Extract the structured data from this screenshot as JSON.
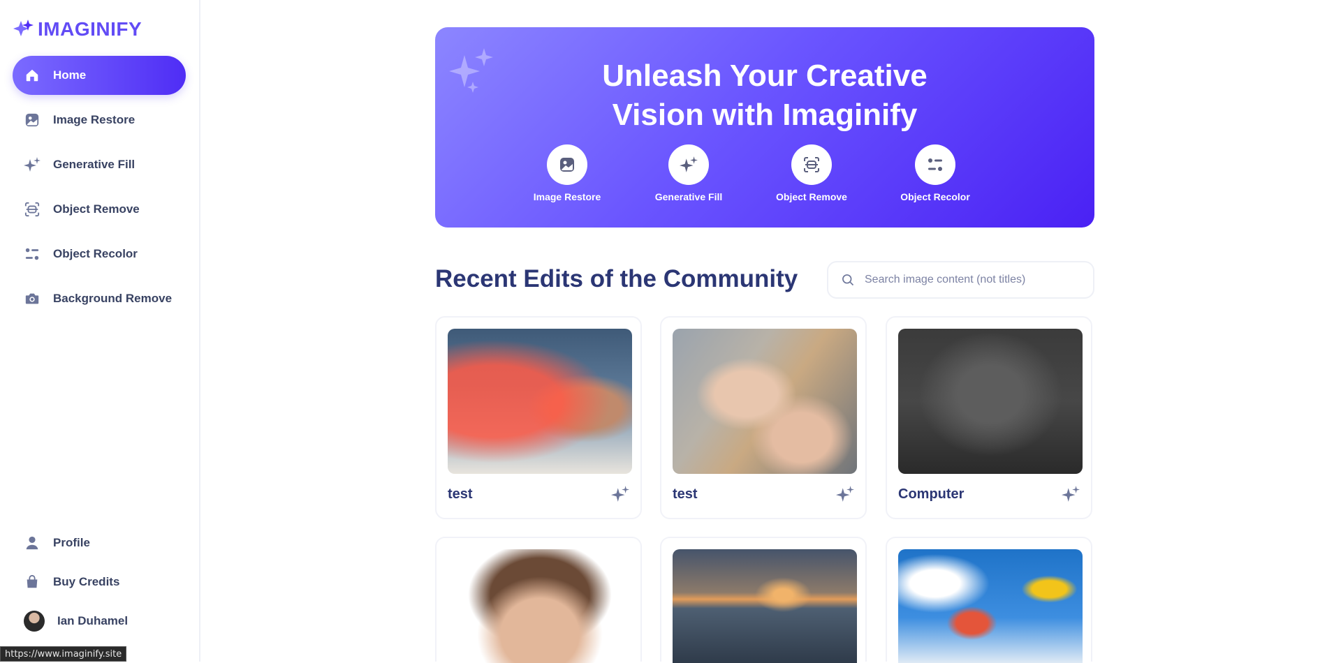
{
  "brand": {
    "name": "IMAGINIFY",
    "color": "#624cf5"
  },
  "sidebar": {
    "items": [
      {
        "label": "Home",
        "icon": "home-icon",
        "active": true
      },
      {
        "label": "Image Restore",
        "icon": "image-icon"
      },
      {
        "label": "Generative Fill",
        "icon": "stars-icon"
      },
      {
        "label": "Object Remove",
        "icon": "scan-icon"
      },
      {
        "label": "Object Recolor",
        "icon": "filter-icon"
      },
      {
        "label": "Background Remove",
        "icon": "camera-icon"
      }
    ],
    "bottom": [
      {
        "label": "Profile",
        "icon": "profile-icon"
      },
      {
        "label": "Buy Credits",
        "icon": "bag-icon"
      }
    ],
    "user": {
      "name": "Ian Duhamel"
    }
  },
  "hero": {
    "title_line1": "Unleash Your Creative",
    "title_line2": "Vision with Imaginify",
    "tools": [
      {
        "label": "Image Restore",
        "icon": "image-icon"
      },
      {
        "label": "Generative Fill",
        "icon": "stars-icon"
      },
      {
        "label": "Object Remove",
        "icon": "scan-icon"
      },
      {
        "label": "Object Recolor",
        "icon": "filter-icon"
      }
    ]
  },
  "community": {
    "title": "Recent Edits of the Community",
    "search_placeholder": "Search image content (not titles)",
    "cards": [
      {
        "title": "test",
        "icon": "stars-icon"
      },
      {
        "title": "test",
        "icon": "stars-icon"
      },
      {
        "title": "Computer",
        "icon": "stars-icon"
      },
      {
        "title": "",
        "icon": ""
      },
      {
        "title": "",
        "icon": ""
      },
      {
        "title": "",
        "icon": ""
      }
    ]
  },
  "status_url": "https://www.imaginify.site"
}
